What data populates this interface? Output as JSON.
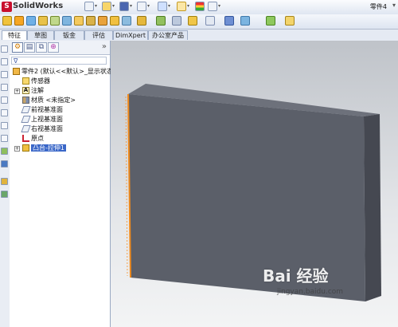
{
  "title_bar": {
    "app_name": "SolidWorks",
    "document_name": "零件4",
    "logo_letter": "S"
  },
  "command_manager": {
    "tabs": [
      {
        "label": "特征",
        "active": true
      },
      {
        "label": "草图",
        "active": false
      },
      {
        "label": "钣金",
        "active": false
      },
      {
        "label": "评估",
        "active": false
      },
      {
        "label": "DimXpert",
        "active": false
      },
      {
        "label": "办公室产品",
        "active": false
      }
    ]
  },
  "feature_manager": {
    "tabs": [
      "feature-tree",
      "property",
      "configuration",
      "dimxpert"
    ],
    "collapse_glyph": "»",
    "filter_glyph": "∇",
    "tree": [
      {
        "label": "零件2 (默认<<默认>_显示状态",
        "icon": "part-icon",
        "level": 0,
        "expander": false
      },
      {
        "label": "传感器",
        "icon": "sensor-icon",
        "level": 1,
        "expander": false
      },
      {
        "label": "注解",
        "icon": "annotation-icon",
        "level": 1,
        "expander": true
      },
      {
        "label": "材质 <未指定>",
        "icon": "material-icon",
        "level": 1,
        "expander": false
      },
      {
        "label": "前视基准面",
        "icon": "plane-icon",
        "level": 1,
        "expander": false
      },
      {
        "label": "上视基准面",
        "icon": "plane-icon",
        "level": 1,
        "expander": false
      },
      {
        "label": "右视基准面",
        "icon": "plane-icon",
        "level": 1,
        "expander": false
      },
      {
        "label": "原点",
        "icon": "origin-icon",
        "level": 1,
        "expander": false
      },
      {
        "label": "凸台-拉伸1",
        "icon": "extrude-icon",
        "level": 1,
        "expander": true,
        "selected": true
      }
    ]
  },
  "watermark": {
    "brand": "Bai 经验",
    "url": "jingyan.baidu.com"
  },
  "colors": {
    "accent_blue": "#3a67c8",
    "edge_highlight": "#f08a1c",
    "model_face": "#5b5f69"
  }
}
